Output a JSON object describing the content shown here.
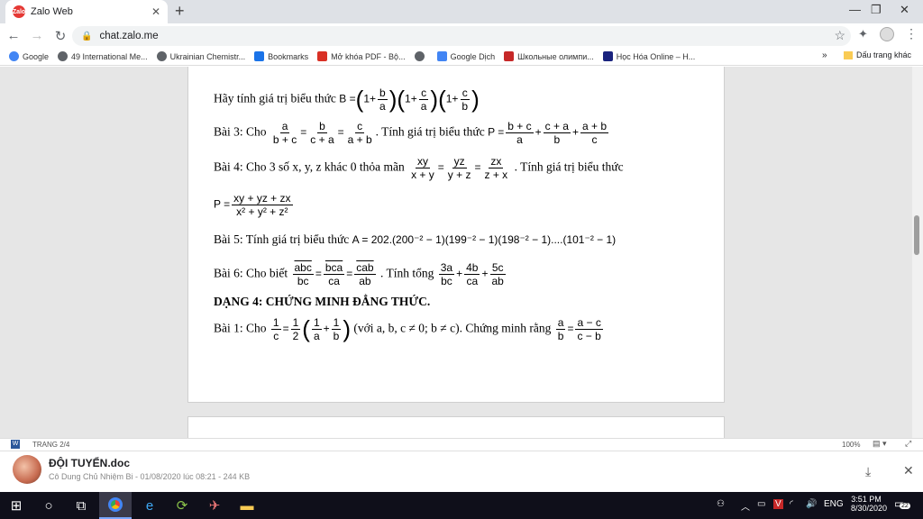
{
  "browser": {
    "tab_title": "Zalo Web",
    "tab_favicon": "zalo-icon",
    "url": "chat.zalo.me",
    "bookmarks": [
      {
        "label": "Google",
        "icon": "google-icon",
        "color": "#4285f4"
      },
      {
        "label": "49 International Me...",
        "icon": "globe-icon",
        "color": "#5f6368"
      },
      {
        "label": "Ukrainian Chemistr...",
        "icon": "globe-icon",
        "color": "#5f6368"
      },
      {
        "label": "Bookmarks",
        "icon": "star-icon",
        "color": "#1a73e8"
      },
      {
        "label": "Mở khóa PDF - Bộ...",
        "icon": "pdf-icon",
        "color": "#d93025"
      },
      {
        "label": "",
        "icon": "globe-icon",
        "color": "#5f6368"
      },
      {
        "label": "Google Dịch",
        "icon": "translate-icon",
        "color": "#4285f4"
      },
      {
        "label": "Школьные олимпи...",
        "icon": "school-icon",
        "color": "#c62828"
      },
      {
        "label": "Học Hóa Online – H...",
        "icon": "paw-icon",
        "color": "#1a237e"
      }
    ],
    "more_bookmarks": "»",
    "other_bookmarks": "Dấu trang khác"
  },
  "document": {
    "lines": {
      "l1_text": "Hãy tính giá trị biểu thức",
      "l2_prefix": "Bài 3: Cho",
      "l2_mid": ". Tính giá trị biểu thức",
      "l3_prefix": "Bài 4: Cho  3 số x, y, z khác 0 thỏa mãn",
      "l3_suffix": ". Tính giá trị biểu thức",
      "l5_prefix": "Bài 5: Tính giá trị biểu thức",
      "l5_expr": "A = 202.(200⁻² − 1)(199⁻² − 1)(198⁻² − 1)....(101⁻² − 1)",
      "l6_prefix": "Bài 6: Cho biết",
      "l6_mid": ". Tính tổng",
      "heading": "DẠNG 4: CHỨNG MINH ĐẲNG THỨC.",
      "l8_prefix": "Bài 1: Cho",
      "l8_cond": "(với a, b, c ≠ 0; b ≠ c). Chứng minh rằng"
    }
  },
  "status": {
    "page_info": "TRANG 2/4",
    "zoom": "100%"
  },
  "file_bar": {
    "file_name": "ĐỘI TUYỂN.doc",
    "meta": "Cô Dung Chủ Nhiệm Bi - 01/08/2020 lúc 08:21 - 244 KB"
  },
  "taskbar": {
    "language": "ENG",
    "time": "3:51 PM",
    "date": "8/30/2020",
    "notifications": "22"
  }
}
